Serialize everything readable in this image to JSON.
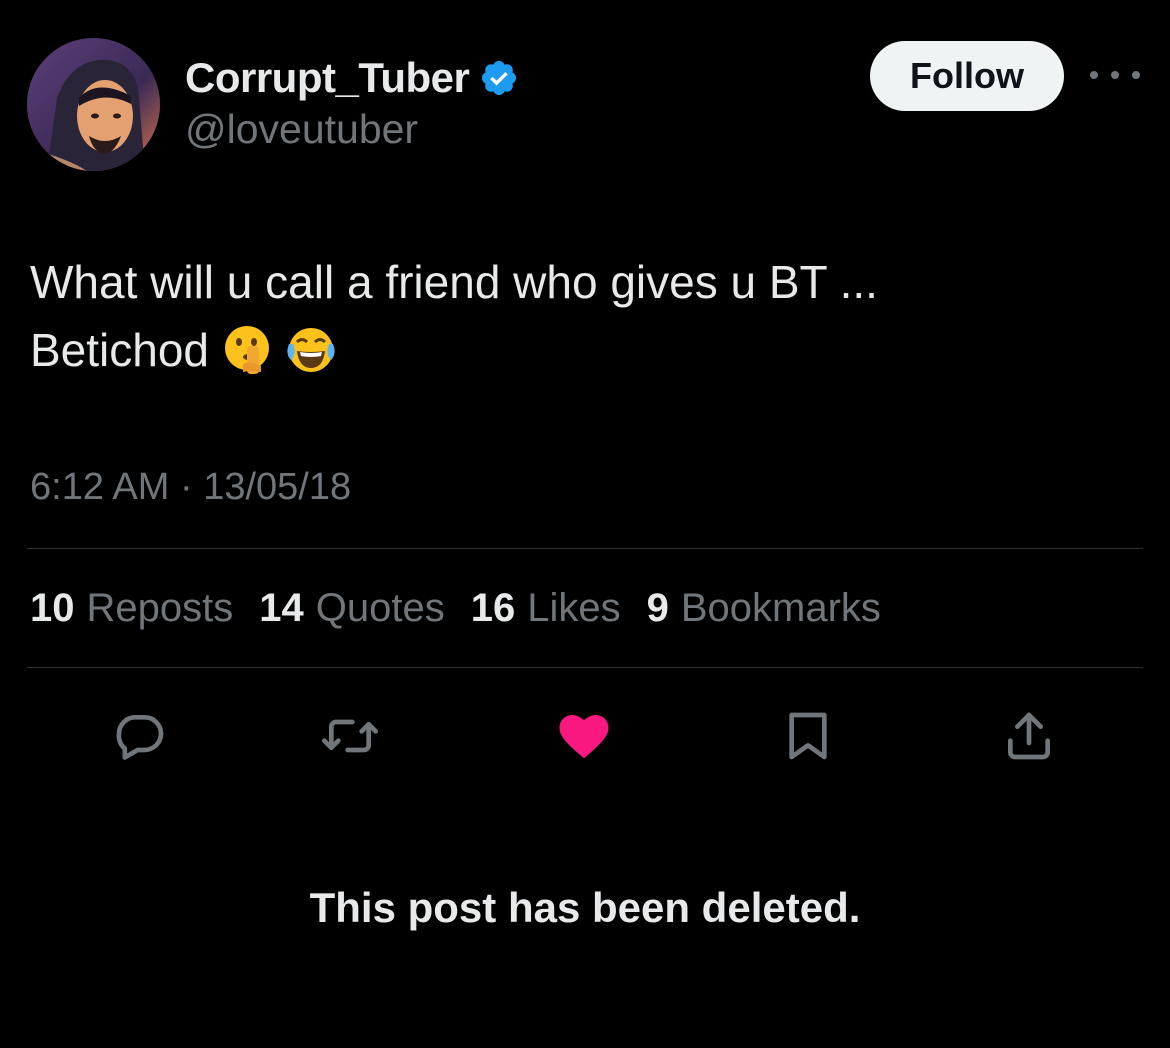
{
  "author": {
    "display_name": "Corrupt_Tuber",
    "handle": "@loveutuber",
    "verified": true
  },
  "header": {
    "follow_label": "Follow"
  },
  "tweet": {
    "line1": "What will u call a friend who gives u BT ...",
    "line2": "Betichod",
    "emojis": [
      "shushing-face",
      "tears-of-joy"
    ],
    "timestamp": "6:12 AM · 13/05/18"
  },
  "stats": [
    {
      "count": "10",
      "label": "Reposts"
    },
    {
      "count": "14",
      "label": "Quotes"
    },
    {
      "count": "16",
      "label": "Likes"
    },
    {
      "count": "9",
      "label": "Bookmarks"
    }
  ],
  "actions": [
    "reply-icon",
    "repost-icon",
    "like-icon",
    "bookmark-icon",
    "share-icon"
  ],
  "notice": "This post has been deleted.",
  "colors": {
    "background": "#000000",
    "primary_text": "#e7e9ea",
    "secondary_text": "#71767b",
    "divider": "#2f3336",
    "verified_blue": "#1d9bf0",
    "like_pink": "#f91880",
    "follow_button_bg": "#eff3f4"
  }
}
